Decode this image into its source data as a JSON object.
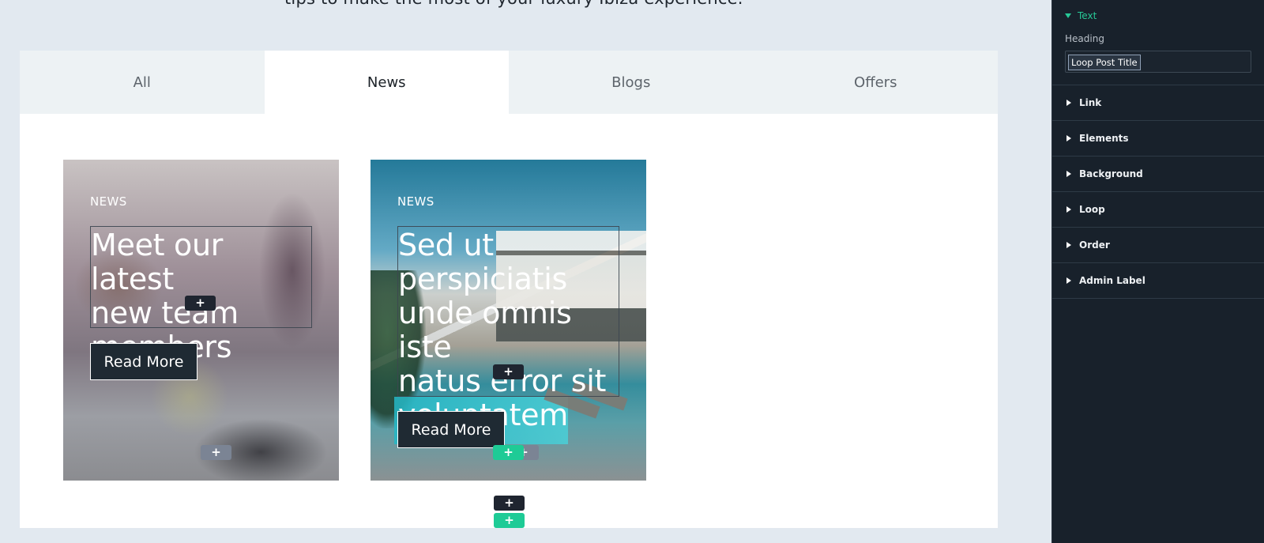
{
  "intro": {
    "text": "tips to make the most of your luxury Ibiza experience."
  },
  "tabs": [
    {
      "label": "All",
      "active": false
    },
    {
      "label": "News",
      "active": true
    },
    {
      "label": "Blogs",
      "active": false
    },
    {
      "label": "Offers",
      "active": false
    }
  ],
  "cards": [
    {
      "tag": "NEWS",
      "title": "Meet our latest\nnew team\nmembers",
      "button": "Read More"
    },
    {
      "tag": "NEWS",
      "title": "Sed ut\nperspiciatis\nunde omnis iste\nnatus error sit\nvoluptatem",
      "button": "Read More"
    }
  ],
  "editor_controls": {
    "add_symbol": "+"
  },
  "panel": {
    "section_text": "Text",
    "heading_label": "Heading",
    "heading_value": "Loop Post Title",
    "sections": [
      "Link",
      "Elements",
      "Background",
      "Loop",
      "Order",
      "Admin Label"
    ]
  },
  "colors": {
    "accent_green": "#1ecb96",
    "panel_bg": "#18212b",
    "canvas_bg": "#e2e9f0",
    "button_dark": "#1f2a33"
  }
}
